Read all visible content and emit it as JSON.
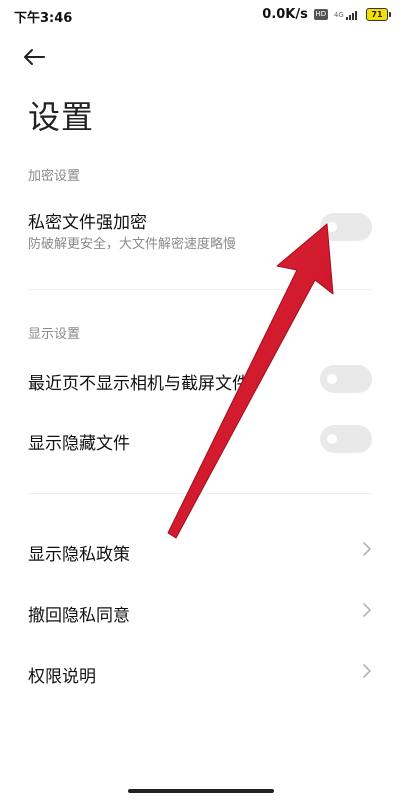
{
  "status_bar": {
    "time": "下午3:46",
    "net_speed": "0.0K/s",
    "hd": "HD",
    "signal": "4G",
    "battery": "71"
  },
  "header": {
    "title": "设置"
  },
  "sections": {
    "encryption": {
      "header": "加密设置",
      "item": {
        "title": "私密文件强加密",
        "subtitle": "防破解更安全，大文件解密速度略慢"
      }
    },
    "display": {
      "header": "显示设置",
      "items": [
        {
          "title": "最近页不显示相机与截屏文件"
        },
        {
          "title": "显示隐藏文件"
        }
      ]
    },
    "links": {
      "items": [
        {
          "title": "显示隐私政策"
        },
        {
          "title": "撤回隐私同意"
        },
        {
          "title": "权限说明"
        }
      ]
    }
  },
  "colors": {
    "annotation_arrow": "#d3172a",
    "toggle_off": "#e9e9e9",
    "section_header": "#8a8a8a"
  },
  "icons": {
    "back": "back-arrow-icon",
    "chevron": "chevron-right-icon"
  }
}
